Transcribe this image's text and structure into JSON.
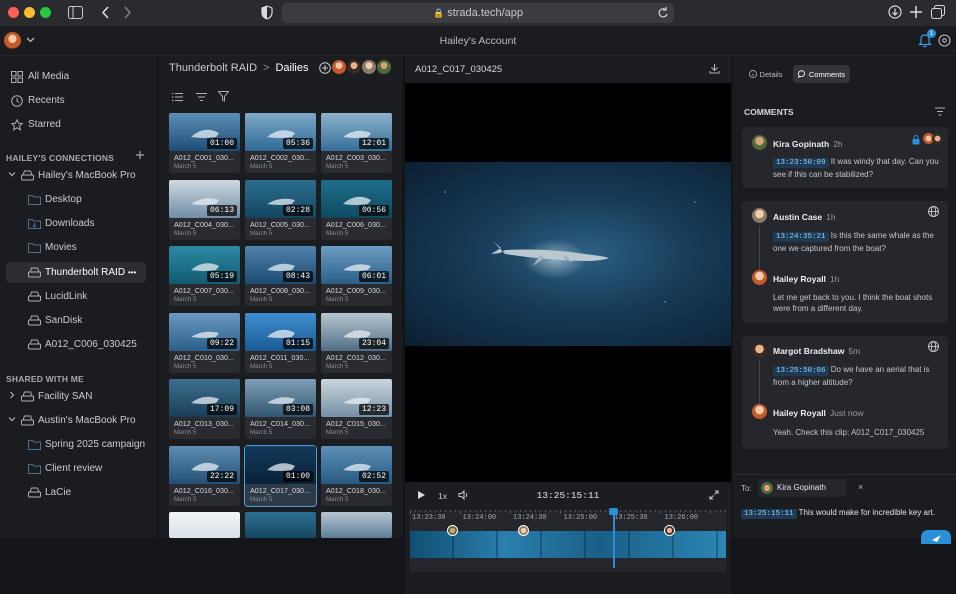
{
  "browser": {
    "url": "strada.tech/app"
  },
  "header": {
    "account_title": "Hailey's Account",
    "notification_count": "1"
  },
  "sidebar": {
    "nav": [
      {
        "label": "All Media",
        "icon": "grid-icon"
      },
      {
        "label": "Recents",
        "icon": "clock-icon"
      },
      {
        "label": "Starred",
        "icon": "star-icon"
      }
    ],
    "connections_header": "HAILEY'S CONNECTIONS",
    "connections": [
      {
        "label": "Hailey's MacBook Pro",
        "icon": "drive-icon"
      },
      {
        "label": "Desktop",
        "icon": "folder-icon"
      },
      {
        "label": "Downloads",
        "icon": "download-folder-icon"
      },
      {
        "label": "Movies",
        "icon": "folder-icon"
      },
      {
        "label": "Thunderbolt RAID",
        "icon": "drive-icon"
      },
      {
        "label": "LucidLink",
        "icon": "drive-icon"
      },
      {
        "label": "SanDisk",
        "icon": "drive-icon"
      },
      {
        "label": "A012_C006_030425",
        "icon": "drive-icon"
      }
    ],
    "shared_header": "SHARED WITH ME",
    "shared": [
      {
        "label": "Facility SAN",
        "icon": "drive-icon"
      },
      {
        "label": "Austin's MacBook Pro",
        "icon": "drive-icon"
      },
      {
        "label": "Spring 2025 campaign",
        "icon": "folder-icon"
      },
      {
        "label": "Client review",
        "icon": "folder-icon"
      },
      {
        "label": "LaCie",
        "icon": "drive-icon"
      }
    ],
    "more_label": "•••"
  },
  "browser_panel": {
    "breadcrumb": [
      "Thunderbolt RAID",
      "Dailies"
    ],
    "separator": ">",
    "clips": [
      {
        "name": "A012_C001_030...",
        "date": "March 5",
        "duration": "01:00"
      },
      {
        "name": "A012_C002_030...",
        "date": "March 5",
        "duration": "05:36"
      },
      {
        "name": "A012_C003_030...",
        "date": "March 5",
        "duration": "12:01"
      },
      {
        "name": "A012_C004_030...",
        "date": "March 5",
        "duration": "06:13"
      },
      {
        "name": "A012_C005_030...",
        "date": "March 5",
        "duration": "02:28"
      },
      {
        "name": "A012_C006_030...",
        "date": "March 5",
        "duration": "00:56"
      },
      {
        "name": "A012_C007_030...",
        "date": "March 5",
        "duration": "05:19"
      },
      {
        "name": "A012_C008_030...",
        "date": "March 5",
        "duration": "08:43"
      },
      {
        "name": "A012_C009_030...",
        "date": "March 5",
        "duration": "06:01"
      },
      {
        "name": "A012_C010_030...",
        "date": "March 5",
        "duration": "09:22"
      },
      {
        "name": "A012_C011_030...",
        "date": "March 5",
        "duration": "01:15"
      },
      {
        "name": "A012_C012_030...",
        "date": "March 5",
        "duration": "23:04"
      },
      {
        "name": "A012_C013_030...",
        "date": "March 5",
        "duration": "17:09"
      },
      {
        "name": "A012_C014_030...",
        "date": "March 5",
        "duration": "03:08"
      },
      {
        "name": "A012_C015_030...",
        "date": "March 5",
        "duration": "12:23"
      },
      {
        "name": "A012_C016_030...",
        "date": "March 5",
        "duration": "22:22"
      },
      {
        "name": "A012_C017_030...",
        "date": "March 5",
        "duration": "01:00"
      },
      {
        "name": "A012_C018_030...",
        "date": "March 5",
        "duration": "02:52"
      }
    ]
  },
  "player": {
    "clip_title": "A012_C017_030425",
    "speed": "1x",
    "timecode": "13:25:15:11",
    "ruler": [
      "13:23:30",
      "13:24:00",
      "13:24:30",
      "13:25:00",
      "13:25:30",
      "13:26:00"
    ]
  },
  "comments_panel": {
    "tabs": {
      "details": "Details",
      "comments": "Comments"
    },
    "title": "COMMENTS",
    "threads": [
      {
        "name": "Kira Gopinath",
        "time": "2h",
        "tc": "13:23:50:09",
        "text1": "It was windy that day. Can you",
        "text2": "see if this can be stabilized?"
      },
      {
        "name": "Austin Case",
        "time": "1h",
        "tc": "13:24:35:21",
        "text1": "Is this the same whale as the",
        "text2": "one we captured from the boat?",
        "reply_name": "Hailey Royall",
        "reply_time": "1h",
        "reply1": "Let me get back to you. I think the boat shots",
        "reply2": "were from a different day."
      },
      {
        "name": "Margot Bradshaw",
        "time": "5m",
        "tc": "13:25:50:06",
        "text1": "Do we have an aerial that is",
        "text2": "from a higher altitude?",
        "reply_name": "Hailey Royall",
        "reply_time": "Just now",
        "reply1": "Yeah. Check this clip: A012_C017_030425",
        "reply2": ""
      }
    ],
    "composer": {
      "to_label": "To:",
      "recipient": "Kira Gopinath",
      "remove": "×",
      "tc": "13:25:15:11",
      "text": "This would make for incredible key art."
    }
  },
  "colors": {
    "accent": "#2a8fd6",
    "timecode_bg": "#1f3a52",
    "selection": "#4a9fd6"
  }
}
